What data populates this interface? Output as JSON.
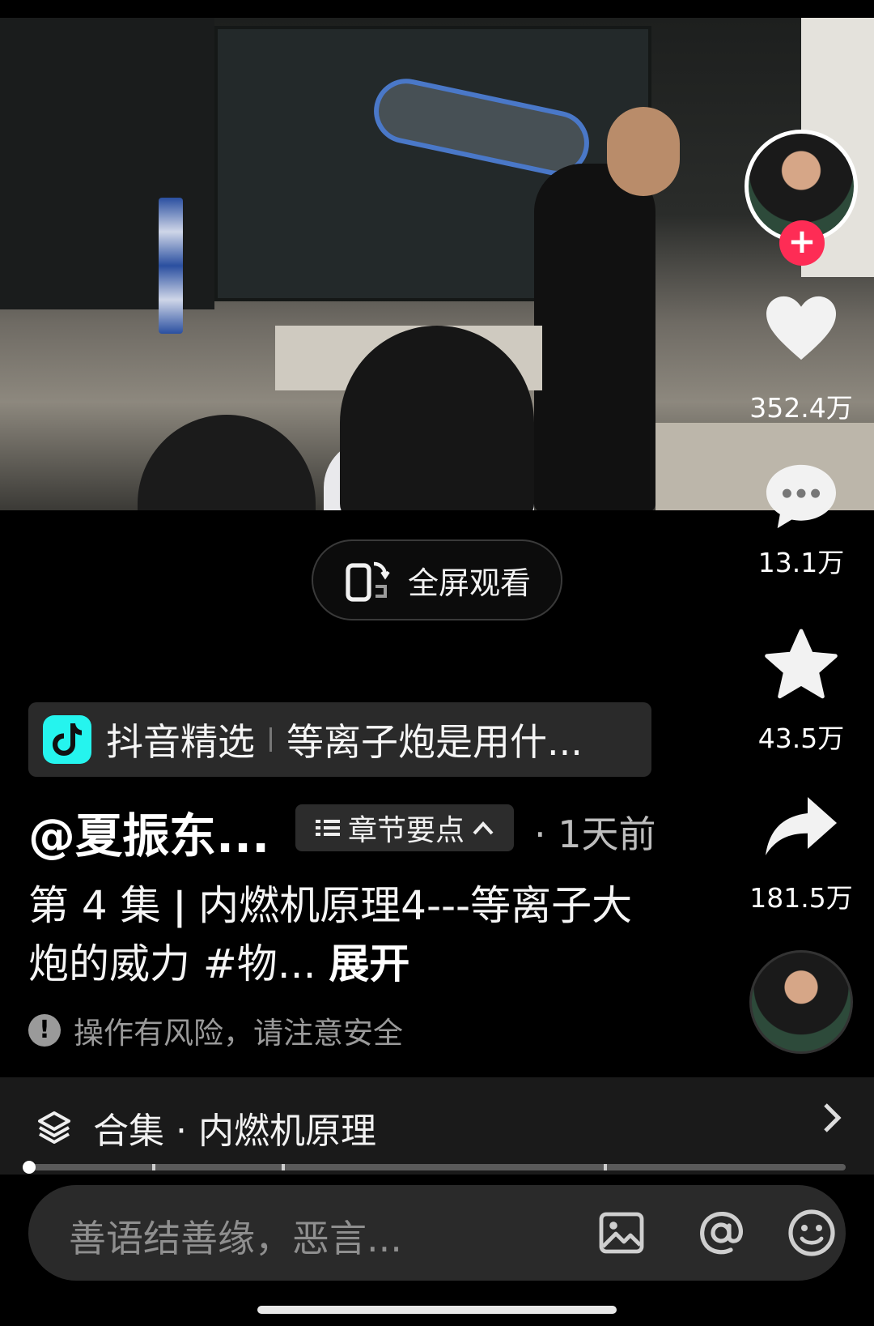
{
  "video": {
    "fullscreen_label": "全屏观看"
  },
  "sidebar": {
    "like_count": "352.4万",
    "comment_count": "13.1万",
    "favorite_count": "43.5万",
    "share_count": "181.5万",
    "follow_icon": "plus-icon"
  },
  "source": {
    "name": "抖音精选",
    "title": "等离子炮是用什..."
  },
  "author": {
    "name": "@夏振东...",
    "chapter_label": "章节要点",
    "time_ago": "· 1天前"
  },
  "description": {
    "text": "第 4 集 ǀ 内燃机原理4---等离子大炮的威力 #物...",
    "expand_label": "展开"
  },
  "warning": {
    "text": "操作有风险，请注意安全"
  },
  "collection": {
    "label": "合集 · 内燃机原理",
    "progress": 0.0
  },
  "comment": {
    "placeholder": "善语结善缘，恶言..."
  },
  "icons": {
    "like": "heart-icon",
    "comment": "comment-bubble-icon",
    "favorite": "star-icon",
    "share": "share-arrow-icon",
    "collection": "layers-icon",
    "image": "image-icon",
    "mention": "at-icon",
    "emoji": "emoji-icon"
  }
}
